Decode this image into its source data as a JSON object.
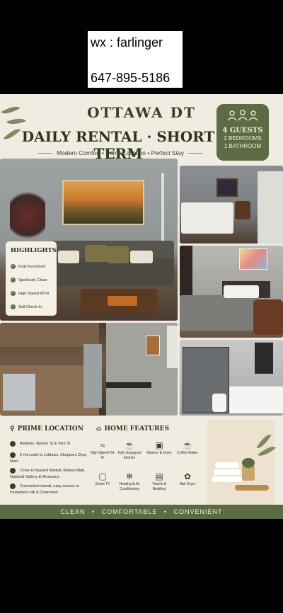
{
  "contact": {
    "wechat": "wx : farlinger",
    "phone": "647-895-5186"
  },
  "flyer": {
    "city": "OTTAWA DT",
    "title": "DAILY RENTAL · SHORT TERM",
    "tagline": {
      "item1": "Modern Comfort",
      "item2": "Prime Location",
      "item3": "Perfect Stay",
      "separator": "•"
    },
    "capacity": {
      "guests": "4 GUESTS",
      "bedrooms": "2 BEDROOMS",
      "bathrooms": "1 BATHROOM"
    },
    "highlights": {
      "heading": "HIGHLIGHTS",
      "items": [
        "Fully Furnished",
        "Spotlessly Clean",
        "High-Speed Wi-Fi",
        "Self Check-In"
      ]
    },
    "location": {
      "heading": "PRIME LOCATION",
      "items": [
        "Address: Nelson St & York St",
        "2-min walk to Loblaws, Shoppers Drug Mart",
        "Close to Byward Market, Rideau Mall, National Gallery & Museums",
        "Convenient transit, easy access to Parliament Hill & Downtown"
      ]
    },
    "features": {
      "heading": "HOME FEATURES",
      "items": [
        {
          "label": "High-Speed Wi-Fi",
          "icon": "wifi-icon"
        },
        {
          "label": "Fully Equipped Kitchen",
          "icon": "pot-icon"
        },
        {
          "label": "Washer & Dryer",
          "icon": "washer-icon"
        },
        {
          "label": "Coffee Maker",
          "icon": "coffee-icon"
        },
        {
          "label": "Smart TV",
          "icon": "tv-icon"
        },
        {
          "label": "Heating & Air Conditioning",
          "icon": "snowflake-icon"
        },
        {
          "label": "Towels & Bedding",
          "icon": "towel-icon"
        },
        {
          "label": "Hair Dryer",
          "icon": "hair-dryer-icon"
        }
      ]
    },
    "footer": {
      "item1": "CLEAN",
      "item2": "COMFORTABLE",
      "item3": "CONVENIENT",
      "separator": "•"
    }
  },
  "colors": {
    "olive": "#5d6b45",
    "cream": "#f1ece2",
    "dark_text": "#2e3322"
  }
}
